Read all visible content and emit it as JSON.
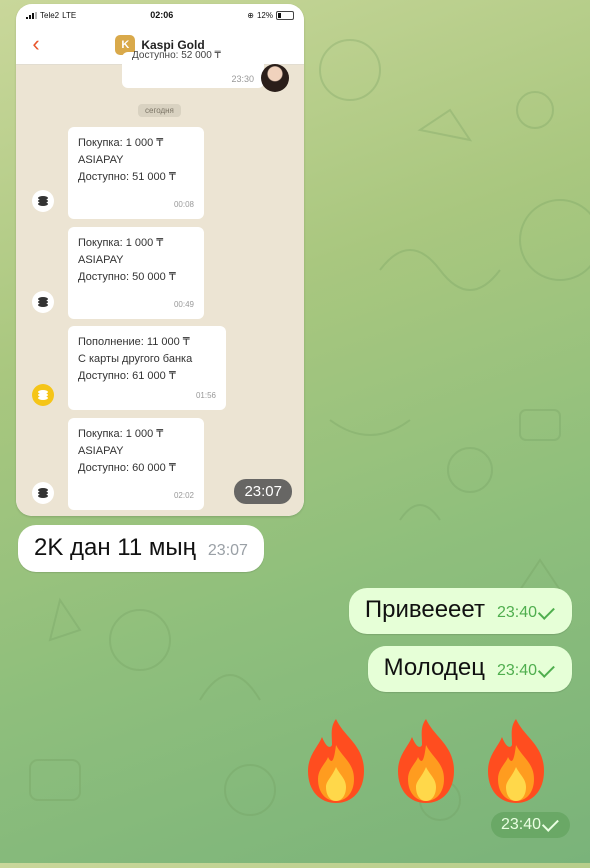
{
  "phone": {
    "carrier": "Tele2",
    "network": "LTE",
    "time": "02:06",
    "battery": "12%",
    "chat_title": "Kaspi Gold",
    "partial_message_text": "Доступно: 52 000 ₸",
    "partial_message_time": "23:30",
    "date_separator": "сегодня",
    "transactions": [
      {
        "lines": [
          "Покупка: 1 000 ₸",
          "ASIAPAY",
          "Доступно: 51 000 ₸"
        ],
        "time": "00:08"
      },
      {
        "lines": [
          "Покупка: 1 000 ₸",
          "ASIAPAY",
          "Доступно: 50 000 ₸"
        ],
        "time": "00:49"
      },
      {
        "lines": [
          "Пополнение: 11 000 ₸",
          "С карты другого банка",
          "Доступно: 61 000 ₸"
        ],
        "time": "01:56"
      },
      {
        "lines": [
          "Покупка: 1 000 ₸",
          "ASIAPAY",
          "Доступно: 60 000 ₸"
        ],
        "time": "02:02"
      }
    ]
  },
  "screenshot_message_time": "23:07",
  "messages": [
    {
      "text": "2K дан 11 мың",
      "time": "23:07",
      "direction": "in"
    },
    {
      "text": "Привеееет",
      "time": "23:40",
      "direction": "out"
    },
    {
      "text": "Молодец",
      "time": "23:40",
      "direction": "out"
    }
  ],
  "emoji_message": {
    "emoji": "fire-emoji",
    "count": 3,
    "time": "23:40"
  },
  "colors": {
    "accent": "#e8542a",
    "outgoing_bubble": "#e6ffd7",
    "read_check": "#4fae4e",
    "kaspi_yellow": "#f5c518"
  }
}
